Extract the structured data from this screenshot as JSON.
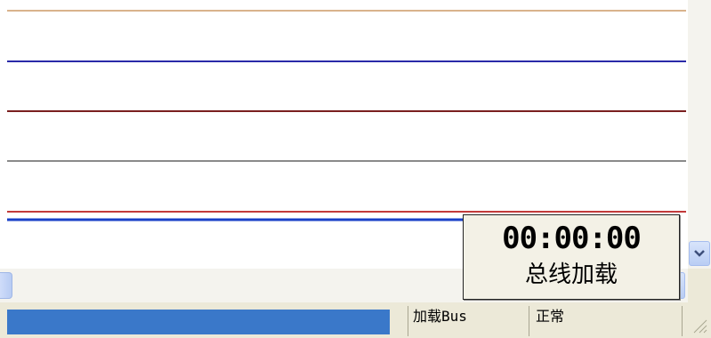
{
  "plot": {
    "traces": [
      {
        "color": "#d9b38c",
        "label": ""
      },
      {
        "color": "#2a2aa8",
        "label": ""
      },
      {
        "color": "#7a1f1f",
        "label": ""
      },
      {
        "color": "#8a8a8a",
        "label": ""
      },
      {
        "color": "#c23a3a",
        "label": ""
      },
      {
        "color": "#1840c8",
        "label": ""
      }
    ]
  },
  "timer": {
    "time": "00:00:00",
    "label": "总线加载"
  },
  "statusbar": {
    "progress_color": "#3a78c9",
    "pane1": "加载Bus",
    "pane2": "正常"
  },
  "icons": {
    "scroll_down": "chevron-down-icon",
    "scroll_right": "chevron-right-icon",
    "resize_grip": "resize-grip-icon"
  }
}
